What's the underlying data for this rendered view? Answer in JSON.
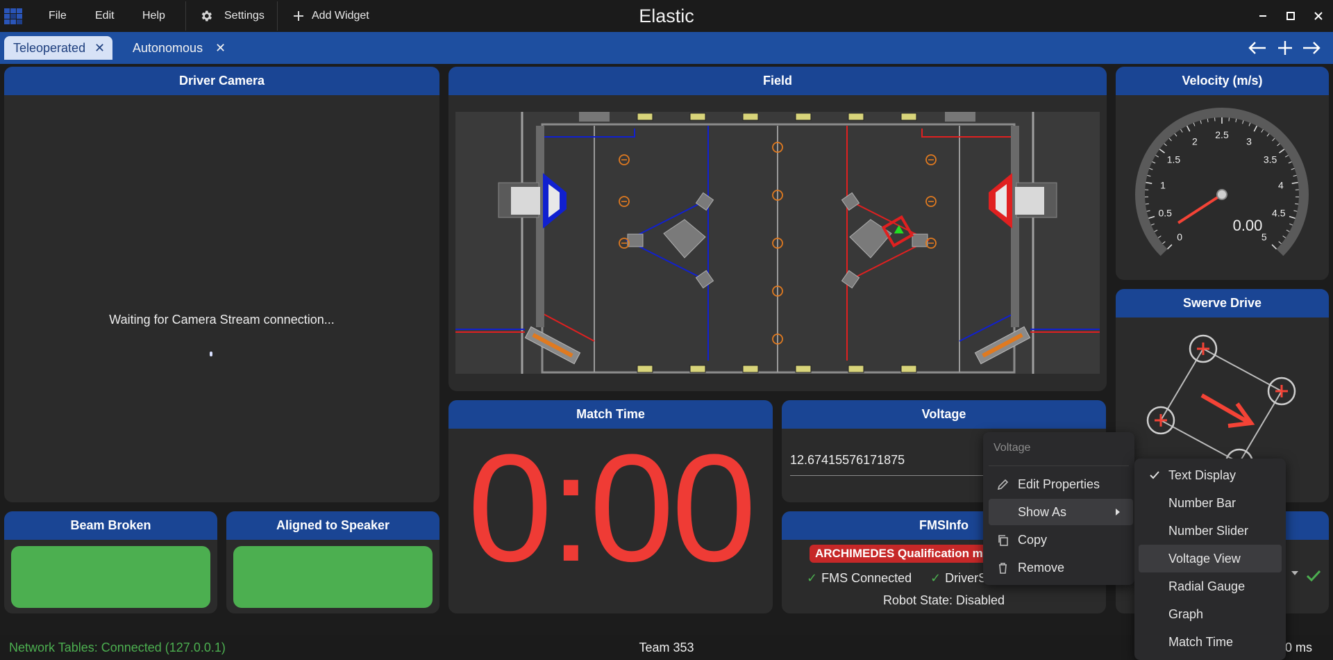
{
  "app": {
    "title": "Elastic"
  },
  "menu": {
    "file": "File",
    "edit": "Edit",
    "help": "Help",
    "settings": "Settings",
    "add_widget": "Add Widget"
  },
  "tabs": [
    {
      "label": "Teleoperated",
      "active": true
    },
    {
      "label": "Autonomous",
      "active": false
    }
  ],
  "widgets": {
    "driver_camera": {
      "title": "Driver Camera",
      "message": "Waiting for Camera Stream connection..."
    },
    "field": {
      "title": "Field"
    },
    "velocity": {
      "title": "Velocity (m/s)",
      "value": 0.0,
      "value_text": "0.00",
      "min": 0,
      "max": 5,
      "ticks": [
        "0",
        "0.5",
        "1",
        "1.5",
        "2",
        "2.5",
        "3",
        "3.5",
        "4",
        "4.5",
        "5"
      ]
    },
    "swerve_drive": {
      "title": "Swerve Drive"
    },
    "match_time": {
      "title": "Match Time",
      "value": "0:00"
    },
    "voltage": {
      "title": "Voltage",
      "value": "12.67415576171875"
    },
    "fms_info": {
      "title": "FMSInfo",
      "event": "ARCHIMEDES Qualification ma",
      "fms_connected": "FMS Connected",
      "driver_station": "DriverS",
      "robot_state": "Robot State: Disabled"
    },
    "beam_broken": {
      "title": "Beam Broken",
      "value": true
    },
    "aligned_to_speaker": {
      "title": "Aligned to Speaker",
      "value": true
    }
  },
  "context_menu": {
    "header": "Voltage",
    "items": [
      "Edit Properties",
      "Show As",
      "Copy",
      "Remove"
    ],
    "show_as_submenu": [
      "Text Display",
      "Number Bar",
      "Number Slider",
      "Voltage View",
      "Radial Gauge",
      "Graph",
      "Match Time"
    ],
    "checked": "Text Display",
    "highlighted": "Voltage View"
  },
  "status": {
    "network": "Network Tables: Connected (127.0.0.1)",
    "team": "Team 353",
    "latency": "0.50 ms"
  },
  "colors": {
    "accent_blue": "#1a4594",
    "tab_bar": "#1e4fa0",
    "bool_true": "#4caf50",
    "match_time": "#ef3b35",
    "alliance_red": "#e02020",
    "alliance_blue": "#1020d0"
  }
}
